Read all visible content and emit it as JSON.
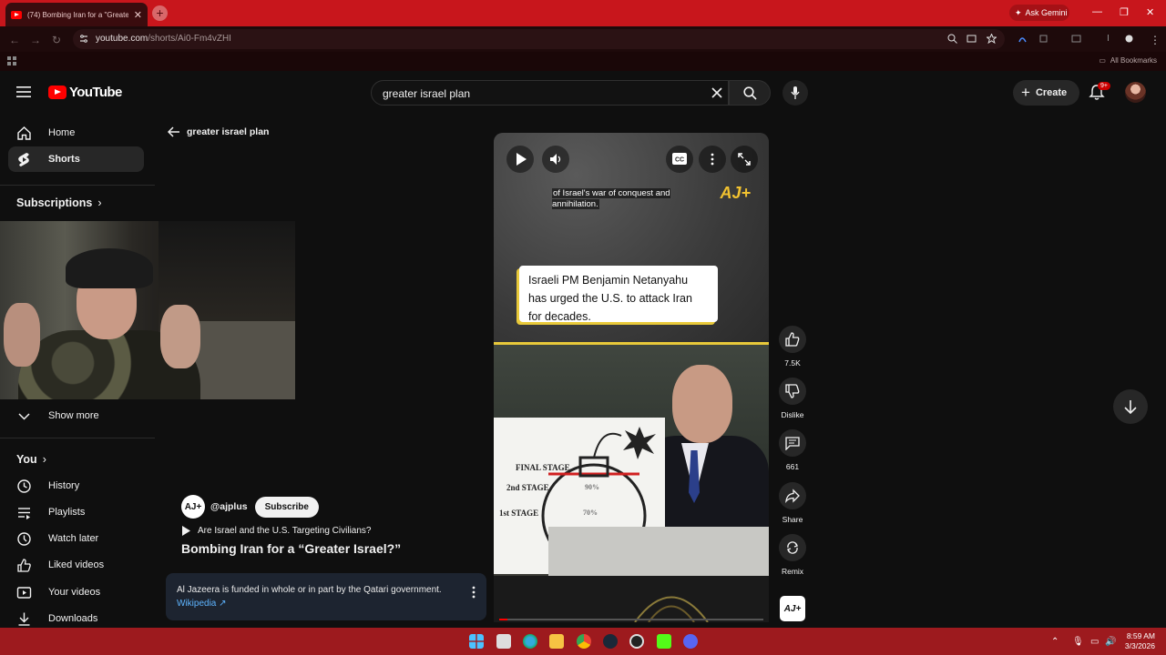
{
  "browser": {
    "tab_title": "(74) Bombing Iran for a \"Greater",
    "url_host": "youtube.com",
    "url_path": "/shorts/Ai0-Fm4vZHI",
    "ask_gemini": "Ask Gemini",
    "all_bookmarks": "All Bookmarks"
  },
  "header": {
    "logo": "YouTube",
    "search_query": "greater israel plan",
    "create_label": "Create",
    "notif_badge": "9+"
  },
  "sidebar": {
    "home": "Home",
    "shorts": "Shorts",
    "subscriptions": "Subscriptions",
    "show_more": "Show more",
    "you": "You",
    "history": "History",
    "playlists": "Playlists",
    "watch_later": "Watch later",
    "liked_videos": "Liked videos",
    "your_videos": "Your videos",
    "downloads": "Downloads"
  },
  "main": {
    "back_label": "greater israel plan",
    "channel_handle": "@ajplus",
    "subscribe": "Subscribe",
    "playlist_title": "Are Israel and the U.S. Targeting Civilians?",
    "short_title": "Bombing Iran for a “Greater Israel?”",
    "info_text": "Al Jazeera is funded in whole or in part by the Qatari government.",
    "info_link": "Wikipedia ↗"
  },
  "video": {
    "caption": "of Israel's war of conquest and annihilation.",
    "quote": "Israeli PM Benjamin Netanyahu has urged the U.S. to attack Iran for decades.",
    "board_final": "FINAL STAGE",
    "board_2nd": "2nd STAGE",
    "board_1st": "1st STAGE",
    "board_90": "90%",
    "board_70": "70%",
    "aj_logo": "AJ+",
    "progress_fraction": 0.03
  },
  "actions": {
    "likes": "7.5K",
    "dislike": "Dislike",
    "comments": "661",
    "share": "Share",
    "remix": "Remix"
  },
  "taskbar": {
    "time": "8:59 AM",
    "date": "3/3/2026"
  },
  "colors": {
    "browser_red": "#c8161c",
    "youtube_red": "#ff0000",
    "accent_yellow": "#e8c93a",
    "link_blue": "#5eb4ff"
  }
}
